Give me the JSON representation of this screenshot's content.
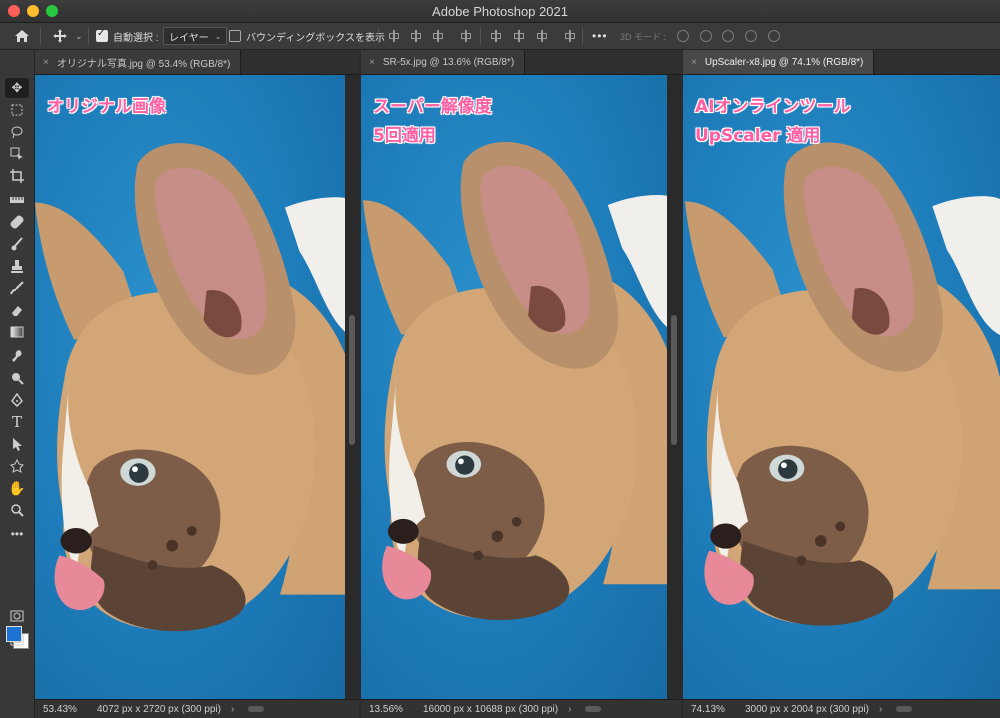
{
  "window": {
    "title": "Adobe Photoshop 2021"
  },
  "options_bar": {
    "auto_select_label": "自動選択 :",
    "auto_select_checked": true,
    "layer_select": "レイヤー",
    "bounding_box_label": "バウンディングボックスを表示",
    "bounding_box_checked": false,
    "more": "•••",
    "mode_label": "3D モード :"
  },
  "tools": [
    "move-icon",
    "marquee-icon",
    "lasso-icon",
    "object-select-icon",
    "crop-icon",
    "ruler-icon",
    "healing-icon",
    "brush-icon",
    "stamp-icon",
    "history-brush-icon",
    "eraser-icon",
    "gradient-icon",
    "smudge-icon",
    "dodge-icon",
    "pen-icon",
    "type-icon",
    "path-select-icon",
    "shape-icon",
    "hand-icon",
    "zoom-icon",
    "more-tools-icon"
  ],
  "colors": {
    "foreground": "#1c73d3",
    "background": "#ffffff",
    "overlay_text": "#ff5fa2"
  },
  "documents": [
    {
      "tab": "オリジナル写真.jpg @ 53.4% (RGB/8*)",
      "active": false,
      "labels": [
        "オリジナル画像"
      ],
      "zoom": "53.43%",
      "dims": "4072 px x 2720 px (300 ppi)"
    },
    {
      "tab": "SR-5x.jpg @ 13.6% (RGB/8*)",
      "active": false,
      "labels": [
        "スーパー解像度",
        "5回適用"
      ],
      "zoom": "13.56%",
      "dims": "16000 px x 10688 px (300 ppi)"
    },
    {
      "tab": "UpScaler-x8.jpg @ 74.1% (RGB/8*)",
      "active": true,
      "labels": [
        "AIオンラインツール",
        "UpScaler 適用"
      ],
      "zoom": "74.13%",
      "dims": "3000 px x 2004 px (300 ppi)"
    }
  ]
}
